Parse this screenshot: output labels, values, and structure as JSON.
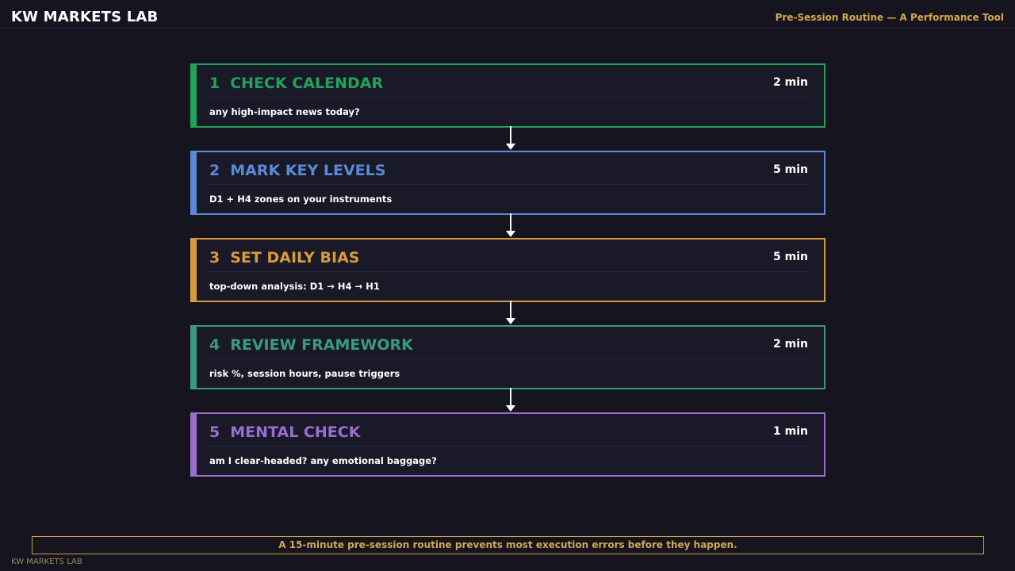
{
  "header": {
    "brand": "KW MARKETS LAB",
    "tagline": "Pre-Session Routine — A Performance Tool"
  },
  "steps": [
    {
      "number": "1",
      "title": "CHECK CALENDAR",
      "duration": "2 min",
      "description": "any high-impact news today?",
      "color": "#21a35a"
    },
    {
      "number": "2",
      "title": "MARK KEY LEVELS",
      "duration": "5 min",
      "description": "D1 + H4 zones on your instruments",
      "color": "#5a8ad6"
    },
    {
      "number": "3",
      "title": "SET DAILY BIAS",
      "duration": "5 min",
      "description": "top-down analysis: D1 → H4 → H1",
      "color": "#d99a3a"
    },
    {
      "number": "4",
      "title": "REVIEW FRAMEWORK",
      "duration": "2 min",
      "description": "risk %, session hours, pause triggers",
      "color": "#3a9a80"
    },
    {
      "number": "5",
      "title": "MENTAL CHECK",
      "duration": "1 min",
      "description": "am I clear-headed? any emotional baggage?",
      "color": "#9a6ed0"
    }
  ],
  "banner": "A 15-minute pre-session routine prevents most execution errors before they happen.",
  "footer": "KW MARKETS LAB"
}
